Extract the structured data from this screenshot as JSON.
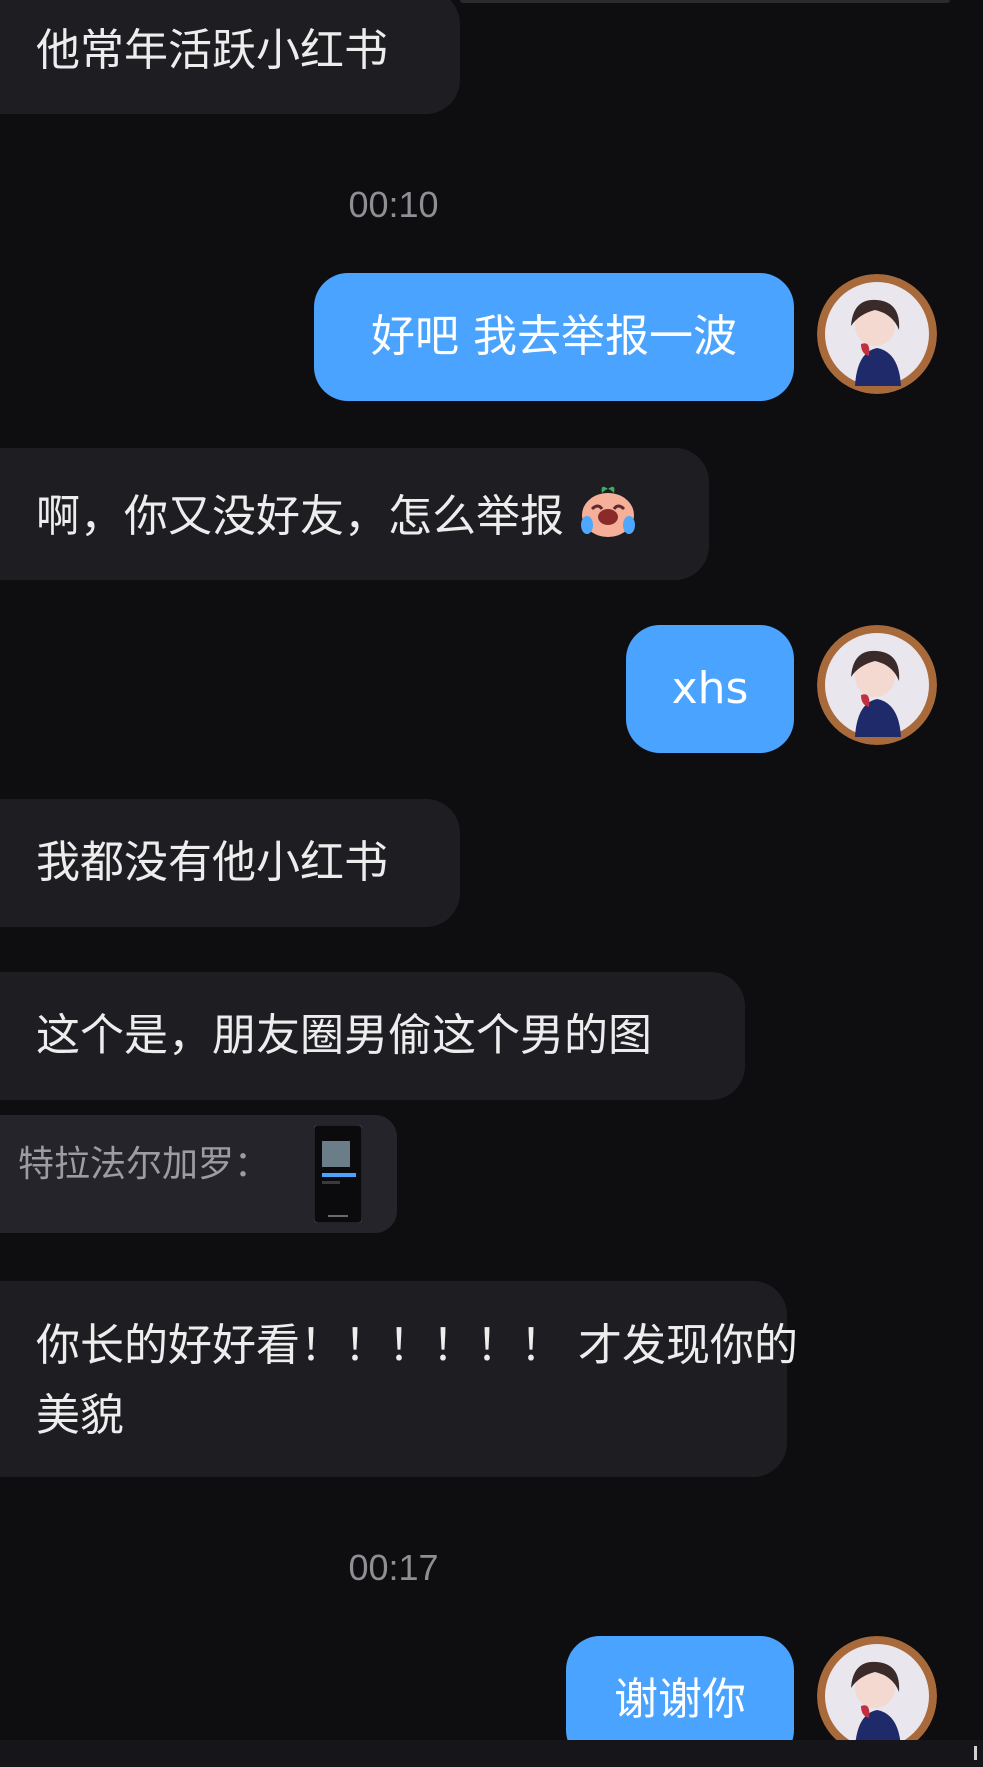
{
  "messages": {
    "m1": "他常年活跃小红书",
    "t1": "00:10",
    "m2": "好吧 我去举报一波",
    "m3": "啊，你又没好友，怎么举报",
    "m4": "xhs",
    "m5": "我都没有他小红书",
    "m6": "这个是，朋友圈男偷这个男的图",
    "quote_label": "特拉法尔加罗：",
    "m7_line1": "你长的好好看！！！！！！ 才发现你的",
    "m7_line2": "美貌",
    "t2": "00:17",
    "m8": "谢谢你"
  },
  "colors": {
    "background": "#0e0e11",
    "incoming_bubble": "#1e1e22",
    "outgoing_bubble": "#4aa3ff",
    "timestamp": "#8e8e93"
  },
  "icons": {
    "emoji": "crying-laughing-peach-emoji",
    "avatar": "user-avatar-illustrated-girl"
  }
}
